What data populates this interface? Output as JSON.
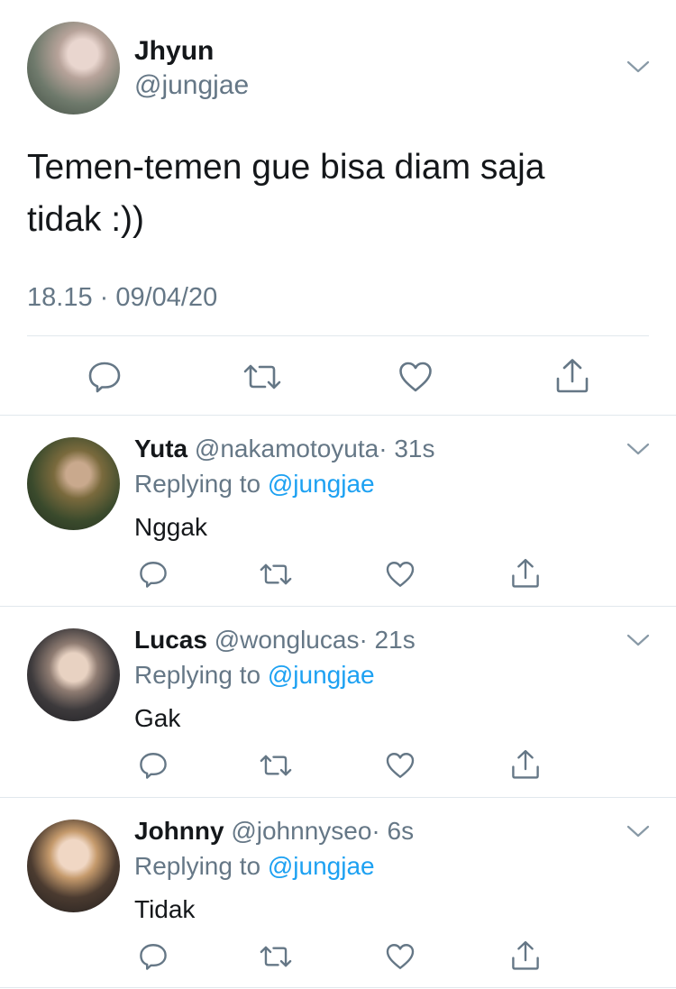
{
  "main_tweet": {
    "name": "Jhyun",
    "handle": "@jungjae",
    "text_line1": "Temen-temen gue bisa diam saja",
    "text_line2": "tidak :))",
    "timestamp": "18.15 · 09/04/20"
  },
  "replies": [
    {
      "name": "Yuta",
      "handle": "@nakamotoyuta",
      "time": "· 31s",
      "replying_prefix": "Replying to",
      "replying_to": "@jungjae",
      "text": "Nggak"
    },
    {
      "name": "Lucas",
      "handle": "@wonglucas",
      "time": "· 21s",
      "replying_prefix": "Replying to",
      "replying_to": "@jungjae",
      "text": "Gak"
    },
    {
      "name": "Johnny",
      "handle": "@johnnyseo",
      "time": "· 6s",
      "replying_prefix": "Replying to",
      "replying_to": "@jungjae",
      "text": "Tidak"
    }
  ],
  "colors": {
    "text": "#14171a",
    "secondary": "#657786",
    "link": "#1da1f2",
    "divider": "#e1e8ed"
  },
  "icons": [
    "chevron-down-icon",
    "reply-icon",
    "retweet-icon",
    "like-icon",
    "share-icon"
  ]
}
